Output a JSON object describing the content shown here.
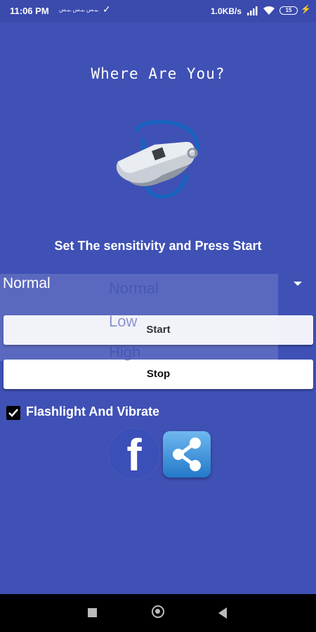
{
  "status_bar": {
    "time": "11:06 PM",
    "notifications": "ـيـس ـيـس ـيـس",
    "network_speed": "1.0KB/s",
    "battery_level": "15",
    "icons": [
      "check-icon",
      "signal-icon",
      "wifi-icon",
      "battery-icon",
      "bolt-icon"
    ]
  },
  "app": {
    "title": "Where Are You?",
    "instruction": "Set The sensitivity and Press Start",
    "accent_color": "#3f51b5"
  },
  "sensitivity": {
    "selected": "Normal",
    "options": [
      "Normal",
      "Low",
      "High"
    ]
  },
  "buttons": {
    "start_label": "Start",
    "stop_label": "Stop"
  },
  "flashlight_vibrate": {
    "label": "Flashlight And Vibrate",
    "checked": true
  },
  "social": {
    "facebook_glyph": "f",
    "icons": [
      "facebook-icon",
      "share-icon"
    ]
  },
  "nav_bar": {
    "icons": [
      "recents-icon",
      "home-icon",
      "back-icon"
    ]
  }
}
